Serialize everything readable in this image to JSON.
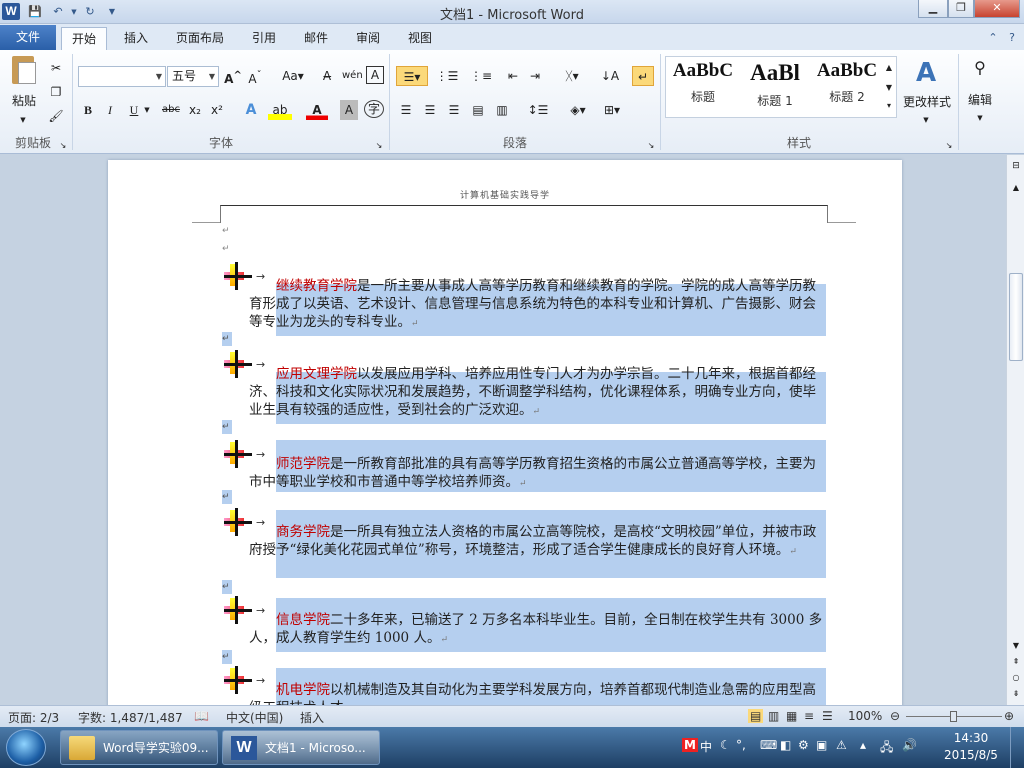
{
  "window": {
    "title": "文档1 - Microsoft Word",
    "app_icon": "W"
  },
  "quick_access": {
    "save": "save-icon",
    "undo": "undo-icon",
    "redo": "redo-icon"
  },
  "tabs": [
    {
      "label": "文件"
    },
    {
      "label": "开始"
    },
    {
      "label": "插入"
    },
    {
      "label": "页面布局"
    },
    {
      "label": "引用"
    },
    {
      "label": "邮件"
    },
    {
      "label": "审阅"
    },
    {
      "label": "视图"
    }
  ],
  "ribbon": {
    "clipboard": {
      "paste": "粘贴",
      "label": "剪贴板"
    },
    "font": {
      "font_name": "",
      "font_size": "五号",
      "bold": "B",
      "italic": "I",
      "underline": "U",
      "strike": "abc",
      "sub": "x₂",
      "sup": "x²",
      "label": "字体"
    },
    "paragraph": {
      "label": "段落"
    },
    "styles": {
      "items": [
        {
          "sample": "AaBbC",
          "name": "标题"
        },
        {
          "sample": "AaBl",
          "name": "标题 1"
        },
        {
          "sample": "AaBbC",
          "name": "标题 2"
        }
      ],
      "change": "更改样式",
      "label": "样式"
    },
    "edit": {
      "label": "编辑"
    }
  },
  "document": {
    "header": "计算机基础实践导学",
    "paragraphs": [
      {
        "name": "继续教育学院",
        "text": "是一所主要从事成人高等学历教育和继续教育的学院。学院的成人高等学历教育形成了以英语、艺术设计、信息管理与信息系统为特色的本科专业和计算机、广告摄影、财会等专业为龙头的专科专业。"
      },
      {
        "name": "应用文理学院",
        "text": "以发展应用学科、培养应用性专门人才为办学宗旨。二十几年来，根据首都经济、科技和文化实际状况和发展趋势，不断调整学科结构，优化课程体系，明确专业方向，使毕业生具有较强的适应性，受到社会的广泛欢迎。"
      },
      {
        "name": "师范学院",
        "text": "是一所教育部批准的具有高等学历教育招生资格的市属公立普通高等学校，主要为市中等职业学校和市普通中等学校培养师资。"
      },
      {
        "name": "商务学院",
        "text": "是一所具有独立法人资格的市属公立高等院校，是高校“文明校园”单位，并被市政府授予“绿化美化花园式单位”称号，环境整洁，形成了适合学生健康成长的良好育人环境。"
      },
      {
        "name": "信息学院",
        "text": "二十多年来，已输送了 2 万多名本科毕业生。目前，全日制在校学生共有 3000 多人，成人教育学生约 1000 人。"
      },
      {
        "name": "机电学院",
        "text": "以机械制造及其自动化为主要学科发展方向，培养首都现代制造业急需的应用型高级工程技术人才。"
      }
    ]
  },
  "status": {
    "page": "页面: 2/3",
    "words": "字数: 1,487/1,487",
    "lang": "中文(中国)",
    "mode": "插入",
    "zoom": "100%"
  },
  "taskbar": {
    "items": [
      {
        "label": "Word导学实验09..."
      },
      {
        "label": "文档1 - Microso..."
      }
    ],
    "ime": "中",
    "time": "14:30",
    "date": "2015/8/5"
  }
}
